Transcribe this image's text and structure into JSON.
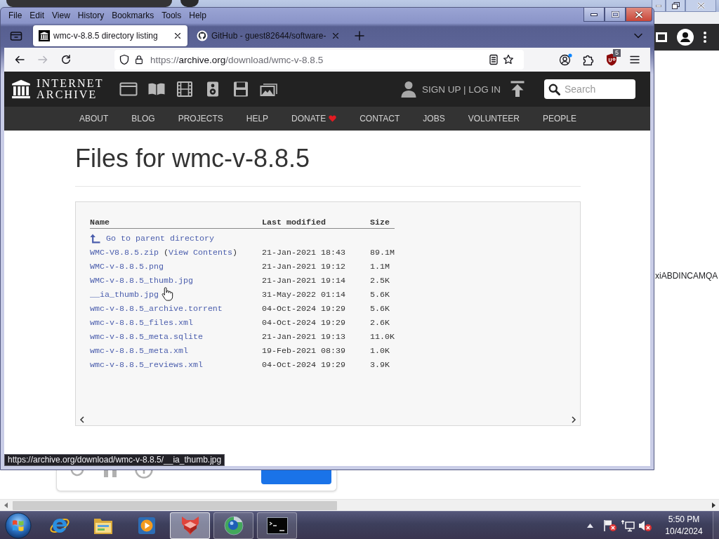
{
  "back_window": {
    "page_text": "xiABDINCAMQA"
  },
  "browser": {
    "menu": [
      "File",
      "Edit",
      "View",
      "History",
      "Bookmarks",
      "Tools",
      "Help"
    ],
    "tabs": [
      {
        "title": "wmc-v-8.8.5 directory listing",
        "selected": true
      },
      {
        "title": "GitHub - guest82644/software-",
        "selected": false
      }
    ],
    "navigation": {
      "back_disabled": false,
      "forward_disabled": true
    },
    "address": {
      "scheme": "https://",
      "host": "archive.org",
      "path": "/download/wmc-v-8.8.5"
    },
    "extension_badge": "5",
    "status_url": "https://archive.org/download/wmc-v-8.8.5/__ia_thumb.jpg"
  },
  "site": {
    "logo_lines": [
      "INTERNET",
      "ARCHIVE"
    ],
    "account_link": "SIGN UP | LOG IN",
    "search": {
      "placeholder": "Search"
    },
    "nav": [
      {
        "label": "ABOUT",
        "kind": "link"
      },
      {
        "label": "BLOG",
        "kind": "link"
      },
      {
        "label": "PROJECTS",
        "kind": "link"
      },
      {
        "label": "HELP",
        "kind": "link"
      },
      {
        "label": "DONATE",
        "kind": "donate"
      },
      {
        "label": "CONTACT",
        "kind": "link"
      },
      {
        "label": "JOBS",
        "kind": "link"
      },
      {
        "label": "VOLUNTEER",
        "kind": "link"
      },
      {
        "label": "PEOPLE",
        "kind": "link"
      }
    ]
  },
  "listing": {
    "title": "Files for wmc-v-8.8.5",
    "columns": [
      "Name",
      "Last modified",
      "Size"
    ],
    "parent_link": "Go to parent directory",
    "rows": [
      {
        "name": "WMC-V8.8.5.zip",
        "contents": {
          "open": "(",
          "link": "View Contents",
          "close": ")"
        },
        "modified": "21-Jan-2021 18:43",
        "size": "89.1M"
      },
      {
        "name": "WMC-v-8.8.5.png",
        "modified": "21-Jan-2021 19:12",
        "size": "1.1M"
      },
      {
        "name": "WMC-v-8.8.5_thumb.jpg",
        "modified": "21-Jan-2021 19:14",
        "size": "2.5K"
      },
      {
        "name": "__ia_thumb.jpg",
        "modified": "31-May-2022 01:14",
        "size": "5.6K"
      },
      {
        "name": "wmc-v-8.8.5_archive.torrent",
        "modified": "04-Oct-2024 19:29",
        "size": "5.6K"
      },
      {
        "name": "wmc-v-8.8.5_files.xml",
        "modified": "04-Oct-2024 19:29",
        "size": "2.6K"
      },
      {
        "name": "wmc-v-8.8.5_meta.sqlite",
        "modified": "21-Jan-2021 19:13",
        "size": "11.0K"
      },
      {
        "name": "wmc-v-8.8.5_meta.xml",
        "modified": "19-Feb-2021 08:39",
        "size": "1.0K"
      },
      {
        "name": "wmc-v-8.8.5_reviews.xml",
        "modified": "04-Oct-2024 19:29",
        "size": "3.9K"
      }
    ]
  },
  "taskbar": {
    "apps": [
      {
        "running": false,
        "selected": false
      },
      {
        "running": false,
        "selected": false
      },
      {
        "running": false,
        "selected": false
      },
      {
        "running": true,
        "selected": true
      },
      {
        "running": true,
        "selected": false
      },
      {
        "running": true,
        "selected": false
      }
    ],
    "clock": {
      "time": "5:50 PM",
      "date": "10/4/2024"
    }
  }
}
